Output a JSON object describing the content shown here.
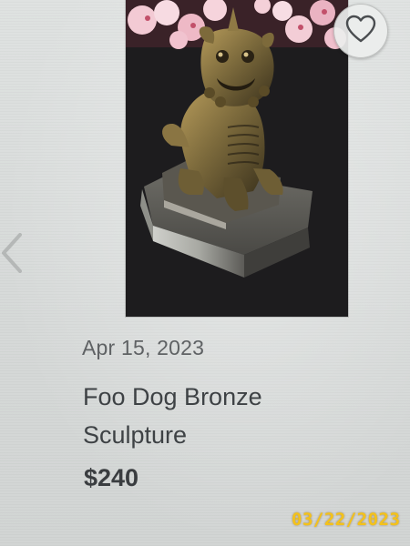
{
  "listing": {
    "date": "Apr 15, 2023",
    "title": "Foo Dog Bronze Sculpture",
    "price": "$240"
  },
  "photo_stamp": "03/22/2023",
  "icons": {
    "favorite": "heart-outline-icon",
    "previous": "chevron-left-icon"
  },
  "colors": {
    "stamp": "#f4c21a",
    "text_primary": "#3e4245",
    "text_secondary": "#5f6264"
  }
}
